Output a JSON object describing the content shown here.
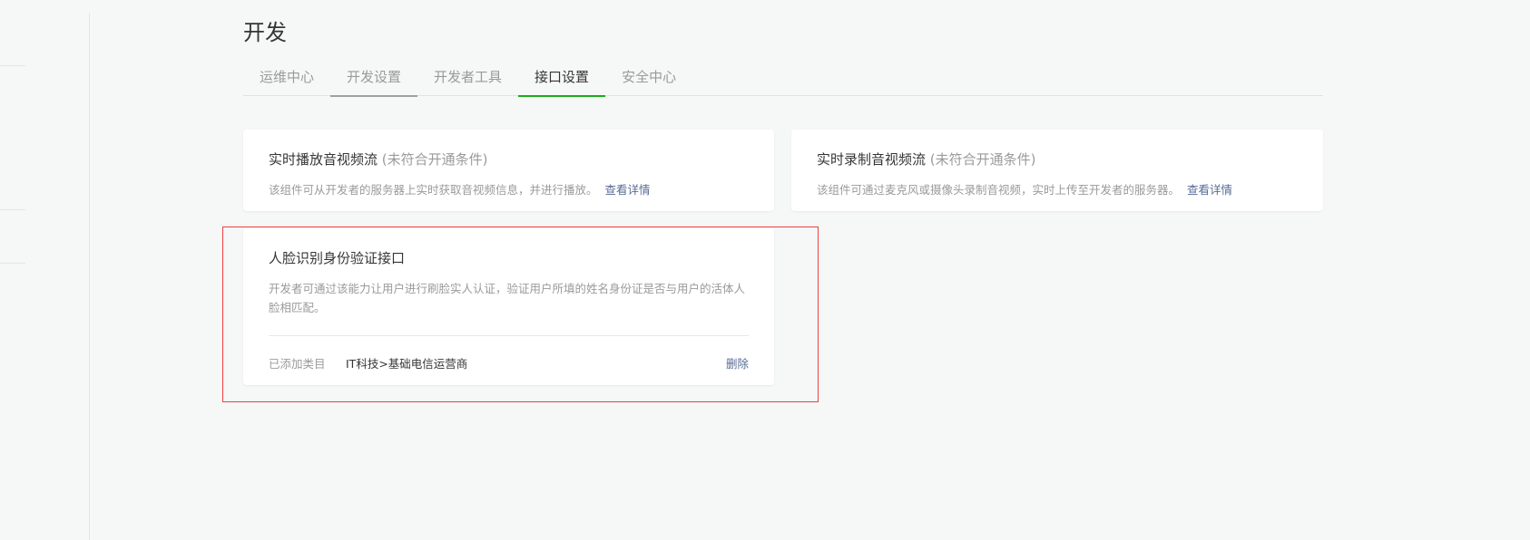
{
  "page": {
    "title": "开发"
  },
  "tabs": [
    {
      "label": "运维中心"
    },
    {
      "label": "开发设置"
    },
    {
      "label": "开发者工具"
    },
    {
      "label": "接口设置"
    },
    {
      "label": "安全中心"
    }
  ],
  "active_tab": "接口设置",
  "cards": [
    {
      "title": "实时播放音视频流",
      "status": "(未符合开通条件)",
      "desc": "该组件可从开发者的服务器上实时获取音视频信息，并进行播放。",
      "link": "查看详情"
    },
    {
      "title": "实时录制音视频流",
      "status": "(未符合开通条件)",
      "desc": "该组件可通过麦克风或摄像头录制音视频，实时上传至开发者的服务器。",
      "link": "查看详情"
    },
    {
      "title": "人脸识别身份验证接口",
      "desc": "开发者可通过该能力让用户进行刷脸实人认证，验证用户所填的姓名身份证是否与用户的活体人脸相匹配。",
      "category_label": "已添加类目",
      "category_value": "IT科技>基础电信运营商",
      "delete_label": "删除"
    }
  ],
  "colors": {
    "accent": "#1aad19",
    "link": "#576b95",
    "highlight": "#f04040"
  }
}
